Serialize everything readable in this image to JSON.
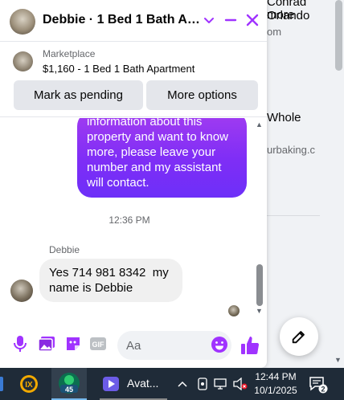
{
  "background_page": {
    "title_line1": "Conrad Orlando",
    "title_line2": "more",
    "subtitle1": "om",
    "title3": "Whole",
    "subtitle2": "urbaking.c"
  },
  "chat": {
    "header": {
      "title": "Debbie · 1 Bed 1 Bath Apar...",
      "accent_color": "#a033ff"
    },
    "listing": {
      "kicker": "Marketplace",
      "title": "$1,160 - 1 Bed 1 Bath Apartment",
      "buttons": {
        "mark_pending": "Mark as pending",
        "more_options": "More options"
      }
    },
    "messages": {
      "outgoing_text": "information about this property and want to know more, please leave your number and my assistant will contact.",
      "timestamp": "12:36 PM",
      "sender_name": "Debbie",
      "incoming_text": "Yes 714 981 8342  my name is Debbie"
    },
    "composer": {
      "placeholder": "Aa"
    }
  },
  "taskbar": {
    "app3_label": "Avat...",
    "badge_45": "45",
    "clock_time": "12:44 PM",
    "clock_date": "10/1/2025",
    "notification_count": "2"
  }
}
